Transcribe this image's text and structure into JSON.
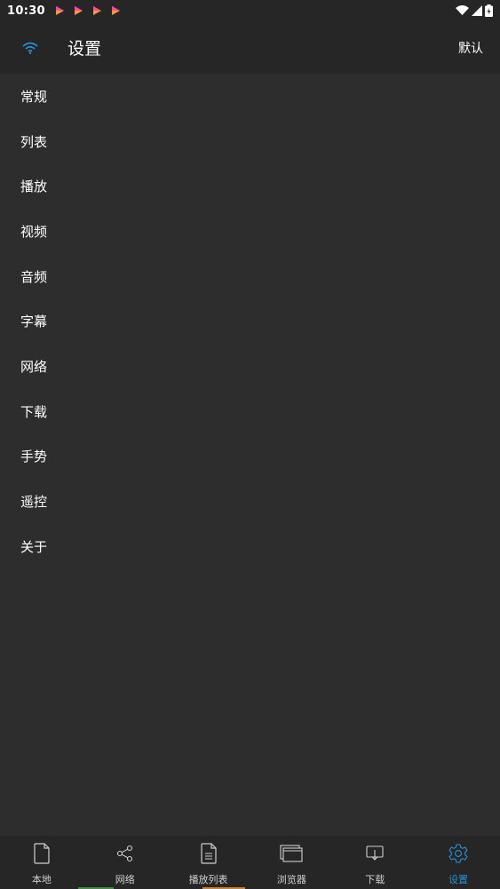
{
  "status_bar": {
    "time": "10:30",
    "notification_icons": [
      "play-icon",
      "play-icon",
      "play-icon",
      "play-icon"
    ]
  },
  "app_bar": {
    "title": "设置",
    "action_label": "默认",
    "accent_color": "#2a8fd6"
  },
  "menu": {
    "items": [
      {
        "label": "常规"
      },
      {
        "label": "列表"
      },
      {
        "label": "播放"
      },
      {
        "label": "视频"
      },
      {
        "label": "音频"
      },
      {
        "label": "字幕"
      },
      {
        "label": "网络"
      },
      {
        "label": "下载"
      },
      {
        "label": "手势"
      },
      {
        "label": "遥控"
      },
      {
        "label": "关于"
      }
    ]
  },
  "bottom_nav": {
    "items": [
      {
        "label": "本地",
        "icon": "file-icon"
      },
      {
        "label": "网络",
        "icon": "share-icon"
      },
      {
        "label": "播放列表",
        "icon": "document-list-icon"
      },
      {
        "label": "浏览器",
        "icon": "browser-window-icon"
      },
      {
        "label": "下载",
        "icon": "download-icon"
      },
      {
        "label": "设置",
        "icon": "gear-icon",
        "active": true
      }
    ],
    "active_color": "#2a8fd6",
    "inactive_color": "#cfcfcf"
  }
}
